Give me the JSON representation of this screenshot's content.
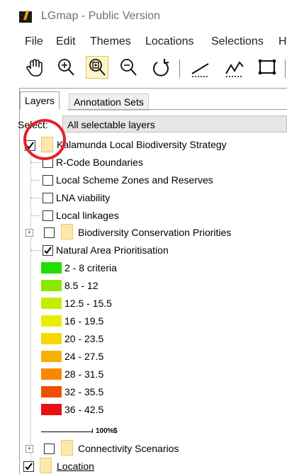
{
  "window": {
    "title": "LGmap - Public Version"
  },
  "menu": [
    "File",
    "Edit",
    "Themes",
    "Locations",
    "Selections",
    "H"
  ],
  "toolbar": {
    "icons": [
      "pan-hand-icon",
      "zoom-in-icon",
      "zoom-box-icon",
      "zoom-out-icon",
      "refresh-icon",
      "measure-line-icon",
      "measure-polyline-icon",
      "measure-area-icon"
    ]
  },
  "tabs": {
    "layers": "Layers",
    "annotation_sets": "Annotation Sets"
  },
  "select": {
    "label": "Select:",
    "value": "All selectable layers"
  },
  "tree": {
    "root": {
      "label": "Kalamunda Local Biodiversity Strategy",
      "checked": true
    },
    "children": [
      {
        "label": "R-Code Boundaries",
        "checked": false
      },
      {
        "label": "Local Scheme Zones and Reserves",
        "checked": false
      },
      {
        "label": "LNA viability",
        "checked": false
      },
      {
        "label": "Local linkages",
        "checked": false
      }
    ],
    "biodiversity": {
      "label": "Biodiversity Conservation Priorities",
      "checked": false
    },
    "natural_area": {
      "label": "Natural Area Prioritisation",
      "checked": true
    },
    "legend": [
      {
        "label": "2 - 8 criteria",
        "color": "#22dd00"
      },
      {
        "label": "8.5 - 12",
        "color": "#88e800"
      },
      {
        "label": "12.5 - 15.5",
        "color": "#c4ee00"
      },
      {
        "label": "16 - 19.5",
        "color": "#e8ee00"
      },
      {
        "label": "20 - 23.5",
        "color": "#f8d800"
      },
      {
        "label": "24 - 27.5",
        "color": "#f8b000"
      },
      {
        "label": "28 - 31.5",
        "color": "#f88800"
      },
      {
        "label": "32 - 35.5",
        "color": "#f05000"
      },
      {
        "label": "36 - 42.5",
        "color": "#e81010"
      }
    ],
    "opacity": "100%",
    "connectivity": {
      "label": "Connectivity Scenarios",
      "checked": false
    },
    "location": {
      "label": "Location",
      "checked": true
    }
  }
}
